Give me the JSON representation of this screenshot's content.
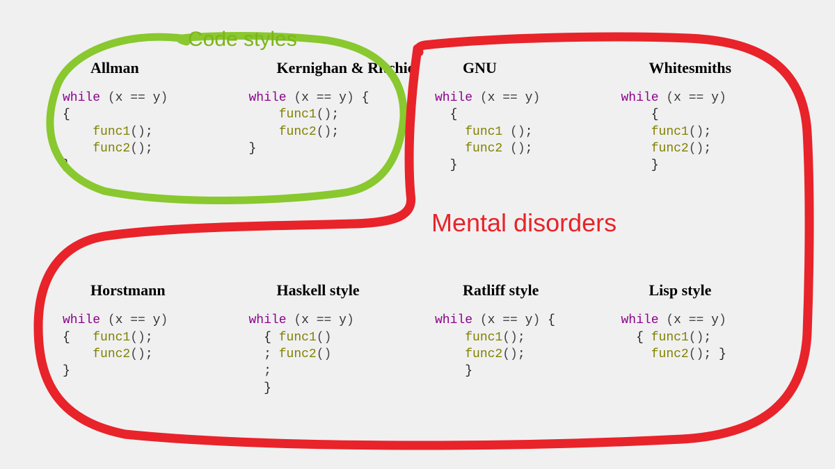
{
  "labels": {
    "green": "Code styles",
    "red": "Mental disorders"
  },
  "styles": [
    {
      "name": "Allman",
      "lines": [
        "while (x == y)",
        "{",
        "    func1();",
        "    func2();",
        "}"
      ]
    },
    {
      "name": "Kernighan & Ritchie",
      "lines": [
        "while (x == y) {",
        "    func1();",
        "    func2();",
        "}"
      ]
    },
    {
      "name": "GNU",
      "lines": [
        "while (x == y)",
        "  {",
        "    func1 ();",
        "    func2 ();",
        "  }"
      ]
    },
    {
      "name": "Whitesmiths",
      "lines": [
        "while (x == y)",
        "    {",
        "    func1();",
        "    func2();",
        "    }"
      ]
    },
    {
      "name": "Horstmann",
      "lines": [
        "while (x == y)",
        "{   func1();",
        "    func2();",
        "}"
      ]
    },
    {
      "name": "Haskell style",
      "lines": [
        "while (x == y)",
        "  { func1()",
        "  ; func2()",
        "  ;",
        "  }"
      ]
    },
    {
      "name": "Ratliff style",
      "lines": [
        "while (x == y) {",
        "    func1();",
        "    func2();",
        "    }"
      ]
    },
    {
      "name": "Lisp style",
      "lines": [
        "while (x == y)",
        "  { func1();",
        "    func2(); }"
      ]
    }
  ]
}
